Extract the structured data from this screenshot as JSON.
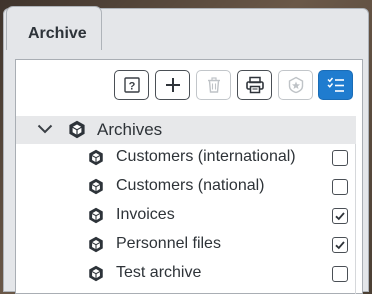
{
  "tab": {
    "label": "Archive"
  },
  "toolbar": {
    "buttons": [
      {
        "name": "help-button",
        "icon": "help-icon",
        "disabled": false
      },
      {
        "name": "add-button",
        "icon": "plus-icon",
        "disabled": false
      },
      {
        "name": "delete-button",
        "icon": "trash-icon",
        "disabled": true
      },
      {
        "name": "print-button",
        "icon": "printer-icon",
        "disabled": false
      },
      {
        "name": "badge-button",
        "icon": "shield-badge-icon",
        "disabled": true
      },
      {
        "name": "checklist-button",
        "icon": "checklist-icon",
        "active": true
      }
    ]
  },
  "tree": {
    "root": {
      "label": "Archives",
      "expanded": true,
      "icon": "archive-cube-icon"
    },
    "items": [
      {
        "label": "Customers (international)",
        "checked": false
      },
      {
        "label": "Customers (national)",
        "checked": false
      },
      {
        "label": "Invoices",
        "checked": true
      },
      {
        "label": "Personnel files",
        "checked": true
      },
      {
        "label": "Test archive",
        "checked": false
      }
    ]
  },
  "colors": {
    "accent": "#1f7ccf",
    "text": "#2e3338",
    "header_bg": "#e7e8ea"
  }
}
